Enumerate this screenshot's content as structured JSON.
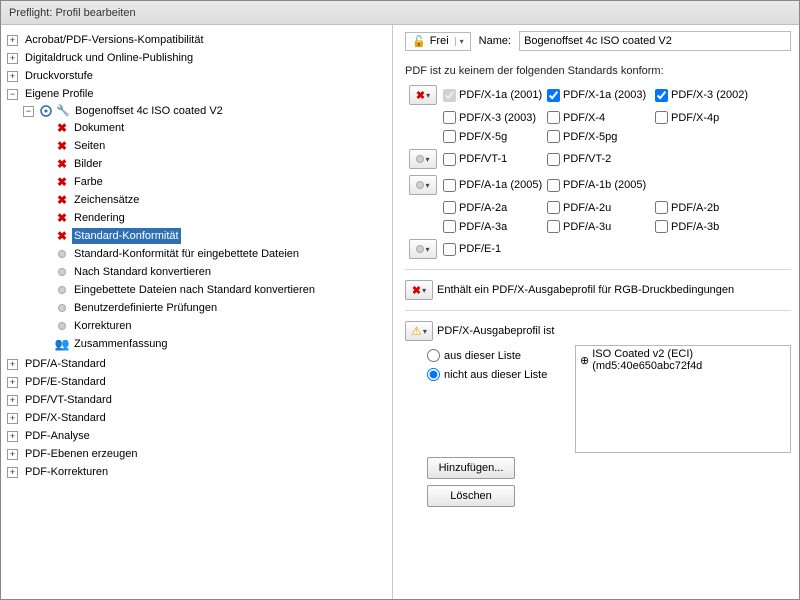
{
  "window": {
    "title": "Preflight: Profil bearbeiten"
  },
  "tree": {
    "n0": "Acrobat/PDF-Versions-Kompatibilität",
    "n1": "Digitaldruck und Online-Publishing",
    "n2": "Druckvorstufe",
    "n3": "Eigene Profile",
    "profile": "Bogenoffset 4c ISO coated V2",
    "items": {
      "i0": "Dokument",
      "i1": "Seiten",
      "i2": "Bilder",
      "i3": "Farbe",
      "i4": "Zeichensätze",
      "i5": "Rendering",
      "i6": "Standard-Konformität",
      "i7": "Standard-Konformität für eingebettete Dateien",
      "i8": "Nach Standard konvertieren",
      "i9": "Eingebettete Dateien nach Standard konvertieren",
      "i10": "Benutzerdefinierte Prüfungen",
      "i11": "Korrekturen",
      "i12": "Zusammenfassung"
    },
    "n4": "PDF/A-Standard",
    "n5": "PDF/E-Standard",
    "n6": "PDF/VT-Standard",
    "n7": "PDF/X-Standard",
    "n8": "PDF-Analyse",
    "n9": "PDF-Ebenen erzeugen",
    "n10": "PDF-Korrekturen"
  },
  "right": {
    "lock": "Frei",
    "nameLabel": "Name:",
    "nameValue": "Bogenoffset 4c ISO coated V2",
    "standardsHeader": "PDF ist zu keinem der folgenden Standards konform:",
    "std": {
      "x1a2001": "PDF/X-1a (2001)",
      "x1a2003": "PDF/X-1a (2003)",
      "x32002": "PDF/X-3 (2002)",
      "x32003": "PDF/X-3 (2003)",
      "x4": "PDF/X-4",
      "x4p": "PDF/X-4p",
      "x5g": "PDF/X-5g",
      "x5pg": "PDF/X-5pg",
      "vt1": "PDF/VT-1",
      "vt2": "PDF/VT-2",
      "a1a": "PDF/A-1a (2005)",
      "a1b": "PDF/A-1b (2005)",
      "a2a": "PDF/A-2a",
      "a2u": "PDF/A-2u",
      "a2b": "PDF/A-2b",
      "a3a": "PDF/A-3a",
      "a3u": "PDF/A-3u",
      "a3b": "PDF/A-3b",
      "e1": "PDF/E-1"
    },
    "rgbLine": "Enthält ein PDF/X-Ausgabeprofil für RGB-Druckbedingungen",
    "outputProfileLabel": "PDF/X-Ausgabeprofil ist",
    "radioFromList": "aus dieser Liste",
    "radioNotFromList": "nicht aus dieser Liste",
    "profileEntry": "ISO Coated v2 (ECI) (md5:40e650abc72f4d",
    "addBtn": "Hinzufügen...",
    "deleteBtn": "Löschen"
  }
}
